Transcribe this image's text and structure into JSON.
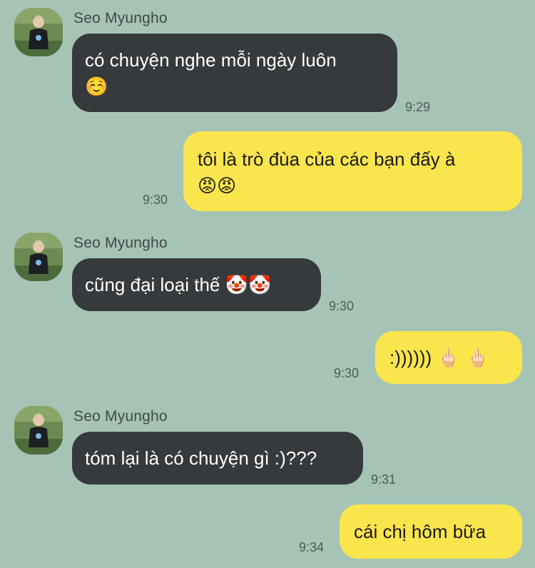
{
  "contact": {
    "name": "Seo Myungho",
    "avatar_icon": "profile-photo-icon"
  },
  "messages": [
    {
      "direction": "incoming",
      "line1": "có chuyện nghe mỗi ngày luôn",
      "emoji": "☺️",
      "time": "9:29"
    },
    {
      "direction": "outgoing",
      "line1": "tôi là trò đùa của các bạn đấy à",
      "emoji": "😡😡",
      "time": "9:30"
    },
    {
      "direction": "incoming",
      "text": "cũng đại loại thế",
      "emoji": "🤡🤡",
      "time": "9:30"
    },
    {
      "direction": "outgoing",
      "text": ":))))))",
      "emoji": "🖕🏻 🖕🏻",
      "time": "9:30"
    },
    {
      "direction": "incoming",
      "text": "tóm lại là có chuyện gì :)???",
      "time": "9:31"
    },
    {
      "direction": "outgoing",
      "text": "cái chị hôm bữa",
      "time": "9:34"
    }
  ],
  "colors": {
    "background": "#a6c4b5",
    "incoming_bubble": "#363a3d",
    "outgoing_bubble": "#fbe54d"
  }
}
